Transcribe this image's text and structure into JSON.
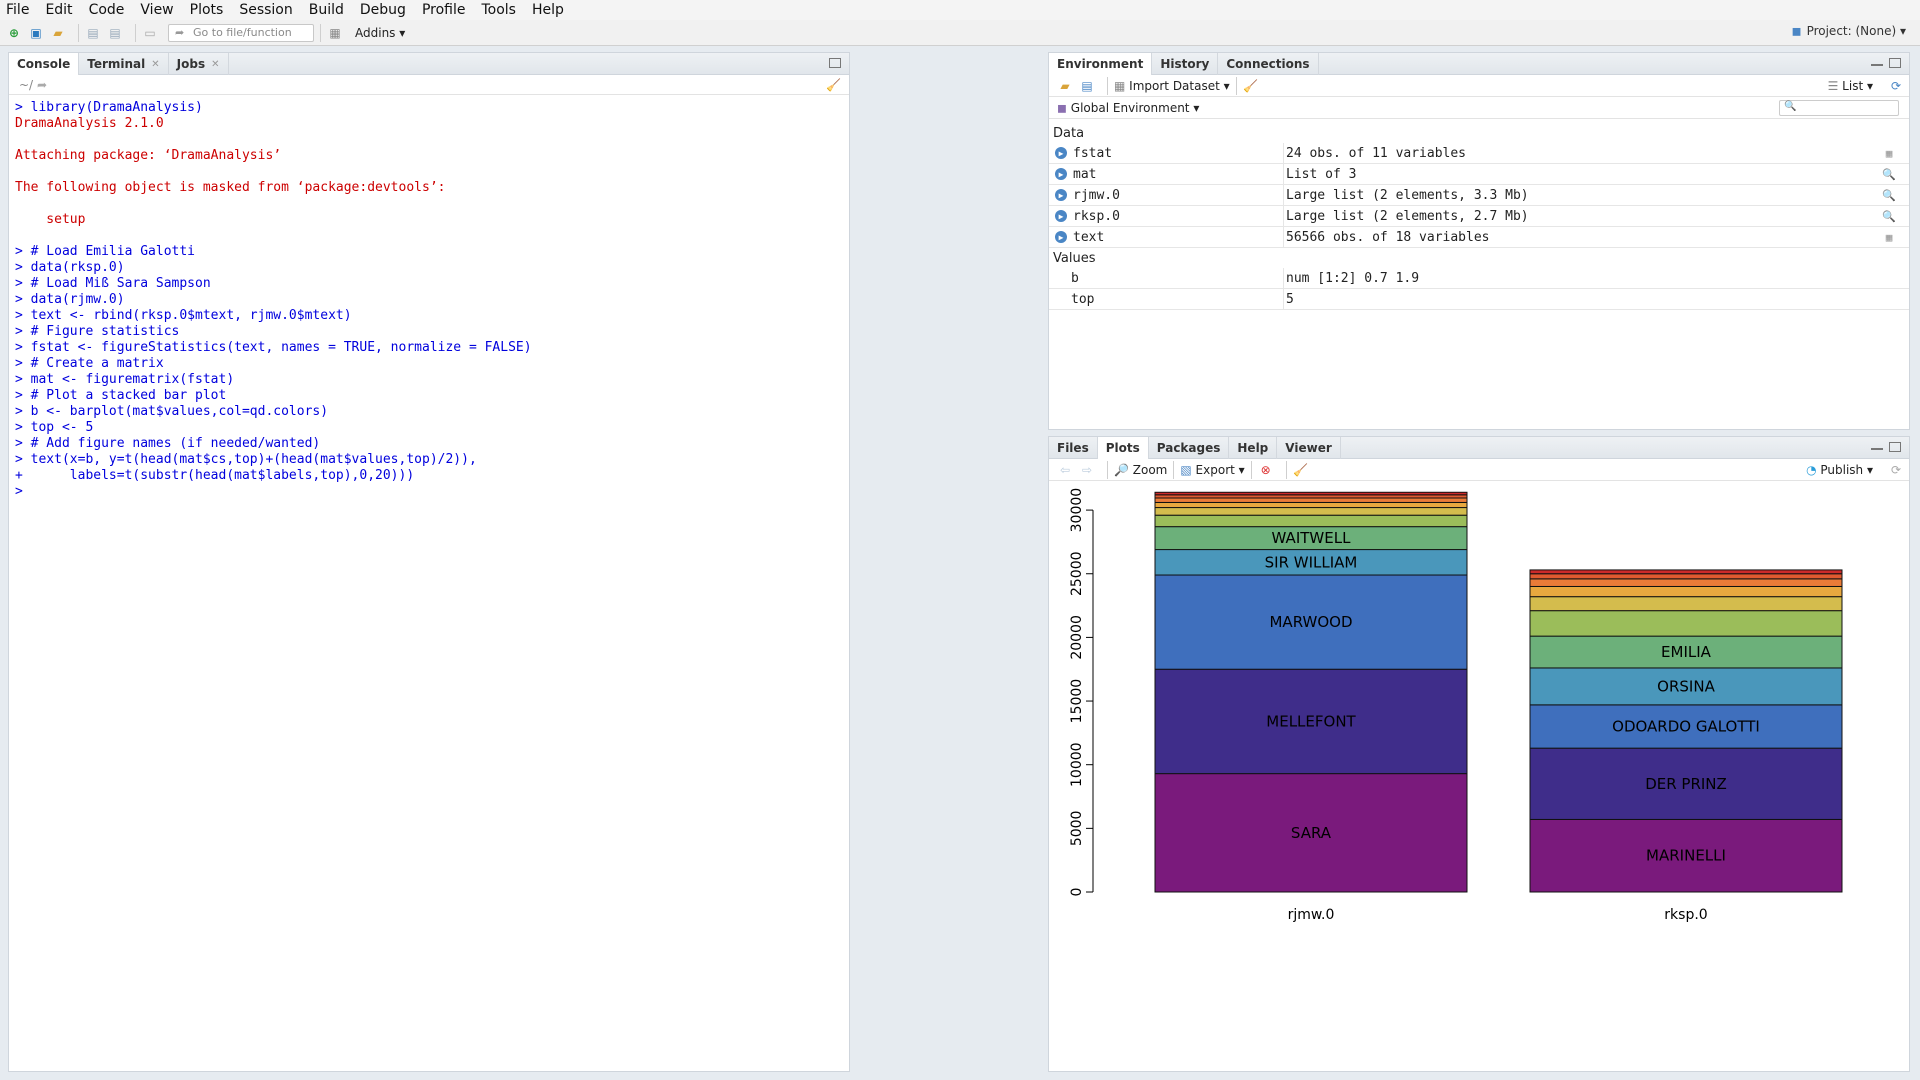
{
  "menu": [
    "File",
    "Edit",
    "Code",
    "View",
    "Plots",
    "Session",
    "Build",
    "Debug",
    "Profile",
    "Tools",
    "Help"
  ],
  "toolbar": {
    "goto_placeholder": "Go to file/function",
    "addins": "Addins"
  },
  "project": "Project: (None)",
  "console": {
    "tabs": [
      "Console",
      "Terminal",
      "Jobs"
    ],
    "path": "~/",
    "lines": [
      {
        "t": "> library(DramaAnalysis)",
        "c": "cmd"
      },
      {
        "t": "DramaAnalysis 2.1.0",
        "c": "err"
      },
      {
        "t": "",
        "c": ""
      },
      {
        "t": "Attaching package: ‘DramaAnalysis’",
        "c": "err"
      },
      {
        "t": "",
        "c": ""
      },
      {
        "t": "The following object is masked from ‘package:devtools’:",
        "c": "err"
      },
      {
        "t": "",
        "c": ""
      },
      {
        "t": "    setup",
        "c": "err"
      },
      {
        "t": "",
        "c": ""
      },
      {
        "t": "> # Load Emilia Galotti",
        "c": "cmd"
      },
      {
        "t": "> data(rksp.0)",
        "c": "cmd"
      },
      {
        "t": "> # Load Miß Sara Sampson",
        "c": "cmd"
      },
      {
        "t": "> data(rjmw.0)",
        "c": "cmd"
      },
      {
        "t": "> text <- rbind(rksp.0$mtext, rjmw.0$mtext)",
        "c": "cmd"
      },
      {
        "t": "> # Figure statistics",
        "c": "cmd"
      },
      {
        "t": "> fstat <- figureStatistics(text, names = TRUE, normalize = FALSE)",
        "c": "cmd"
      },
      {
        "t": "> # Create a matrix",
        "c": "cmd"
      },
      {
        "t": "> mat <- figurematrix(fstat)",
        "c": "cmd"
      },
      {
        "t": "> # Plot a stacked bar plot",
        "c": "cmd"
      },
      {
        "t": "> b <- barplot(mat$values,col=qd.colors)",
        "c": "cmd"
      },
      {
        "t": "> top <- 5",
        "c": "cmd"
      },
      {
        "t": "> # Add figure names (if needed/wanted)",
        "c": "cmd"
      },
      {
        "t": "> text(x=b, y=t(head(mat$cs,top)+(head(mat$values,top)/2)),",
        "c": "cmd"
      },
      {
        "t": "+      labels=t(substr(head(mat$labels,top),0,20)))",
        "c": "cmd"
      },
      {
        "t": ">",
        "c": "cmd"
      }
    ]
  },
  "environment": {
    "tabs": [
      "Environment",
      "History",
      "Connections"
    ],
    "import_dataset": "Import Dataset",
    "view_mode": "List",
    "scope": "Global Environment",
    "data_section": "Data",
    "values_section": "Values",
    "data": [
      {
        "name": "fstat",
        "value": "24 obs. of 11 variables"
      },
      {
        "name": "mat",
        "value": "List of 3"
      },
      {
        "name": "rjmw.0",
        "value": "Large list (2 elements, 3.3 Mb)"
      },
      {
        "name": "rksp.0",
        "value": "Large list (2 elements, 2.7 Mb)"
      },
      {
        "name": "text",
        "value": "56566 obs. of 18 variables"
      }
    ],
    "values": [
      {
        "name": "b",
        "value": "num [1:2] 0.7 1.9"
      },
      {
        "name": "top",
        "value": "5"
      }
    ]
  },
  "plots_pane": {
    "tabs": [
      "Files",
      "Plots",
      "Packages",
      "Help",
      "Viewer"
    ],
    "zoom": "Zoom",
    "export": "Export",
    "publish": "Publish"
  },
  "chart_data": {
    "type": "bar",
    "stacked": true,
    "categories": [
      "rjmw.0",
      "rksp.0"
    ],
    "ylim": [
      0,
      31500
    ],
    "yticks": [
      0,
      5000,
      10000,
      15000,
      20000,
      25000,
      30000
    ],
    "stacks": [
      {
        "segments": [
          {
            "label": "SARA",
            "value": 9300,
            "color": "#7a1a7c"
          },
          {
            "label": "MELLEFONT",
            "value": 8200,
            "color": "#3f2d8a"
          },
          {
            "label": "MARWOOD",
            "value": 7400,
            "color": "#3f6fbd"
          },
          {
            "label": "SIR WILLIAM",
            "value": 2000,
            "color": "#4a97bb"
          },
          {
            "label": "WAITWELL",
            "value": 1800,
            "color": "#6cb07a"
          },
          {
            "label": "",
            "value": 900,
            "color": "#9bbd5a"
          },
          {
            "label": "",
            "value": 600,
            "color": "#d4bc4d"
          },
          {
            "label": "",
            "value": 400,
            "color": "#e8a83f"
          },
          {
            "label": "",
            "value": 350,
            "color": "#ea7b38"
          },
          {
            "label": "",
            "value": 250,
            "color": "#e05a30"
          },
          {
            "label": "",
            "value": 200,
            "color": "#cc2a2a"
          }
        ]
      },
      {
        "segments": [
          {
            "label": "MARINELLI",
            "value": 5700,
            "color": "#7a1a7c"
          },
          {
            "label": "DER PRINZ",
            "value": 5600,
            "color": "#3f2d8a"
          },
          {
            "label": "ODOARDO GALOTTI",
            "value": 3400,
            "color": "#3f6fbd"
          },
          {
            "label": "ORSINA",
            "value": 2900,
            "color": "#4a97bb"
          },
          {
            "label": "EMILIA",
            "value": 2500,
            "color": "#6cb07a"
          },
          {
            "label": "",
            "value": 2000,
            "color": "#9bbd5a"
          },
          {
            "label": "",
            "value": 1100,
            "color": "#d4bc4d"
          },
          {
            "label": "",
            "value": 800,
            "color": "#e8a83f"
          },
          {
            "label": "",
            "value": 600,
            "color": "#ea7b38"
          },
          {
            "label": "",
            "value": 400,
            "color": "#e05a30"
          },
          {
            "label": "",
            "value": 300,
            "color": "#cc2a2a"
          }
        ]
      }
    ]
  }
}
